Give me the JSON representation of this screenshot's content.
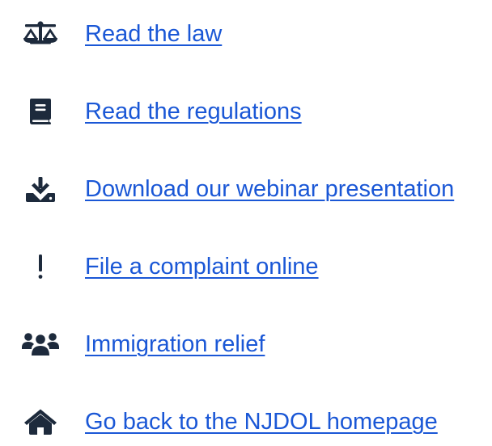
{
  "links": [
    {
      "label": "Read the law",
      "icon": "scales-of-justice-icon"
    },
    {
      "label": "Read the regulations",
      "icon": "book-icon"
    },
    {
      "label": "Download our webinar presentation",
      "icon": "download-icon"
    },
    {
      "label": "File a complaint online",
      "icon": "exclamation-icon"
    },
    {
      "label": "Immigration relief",
      "icon": "people-group-icon"
    },
    {
      "label": "Go back to the NJDOL homepage",
      "icon": "home-icon"
    }
  ],
  "colors": {
    "link": "#1a57d6",
    "icon": "#1d2a3c",
    "background": "#ffffff"
  }
}
